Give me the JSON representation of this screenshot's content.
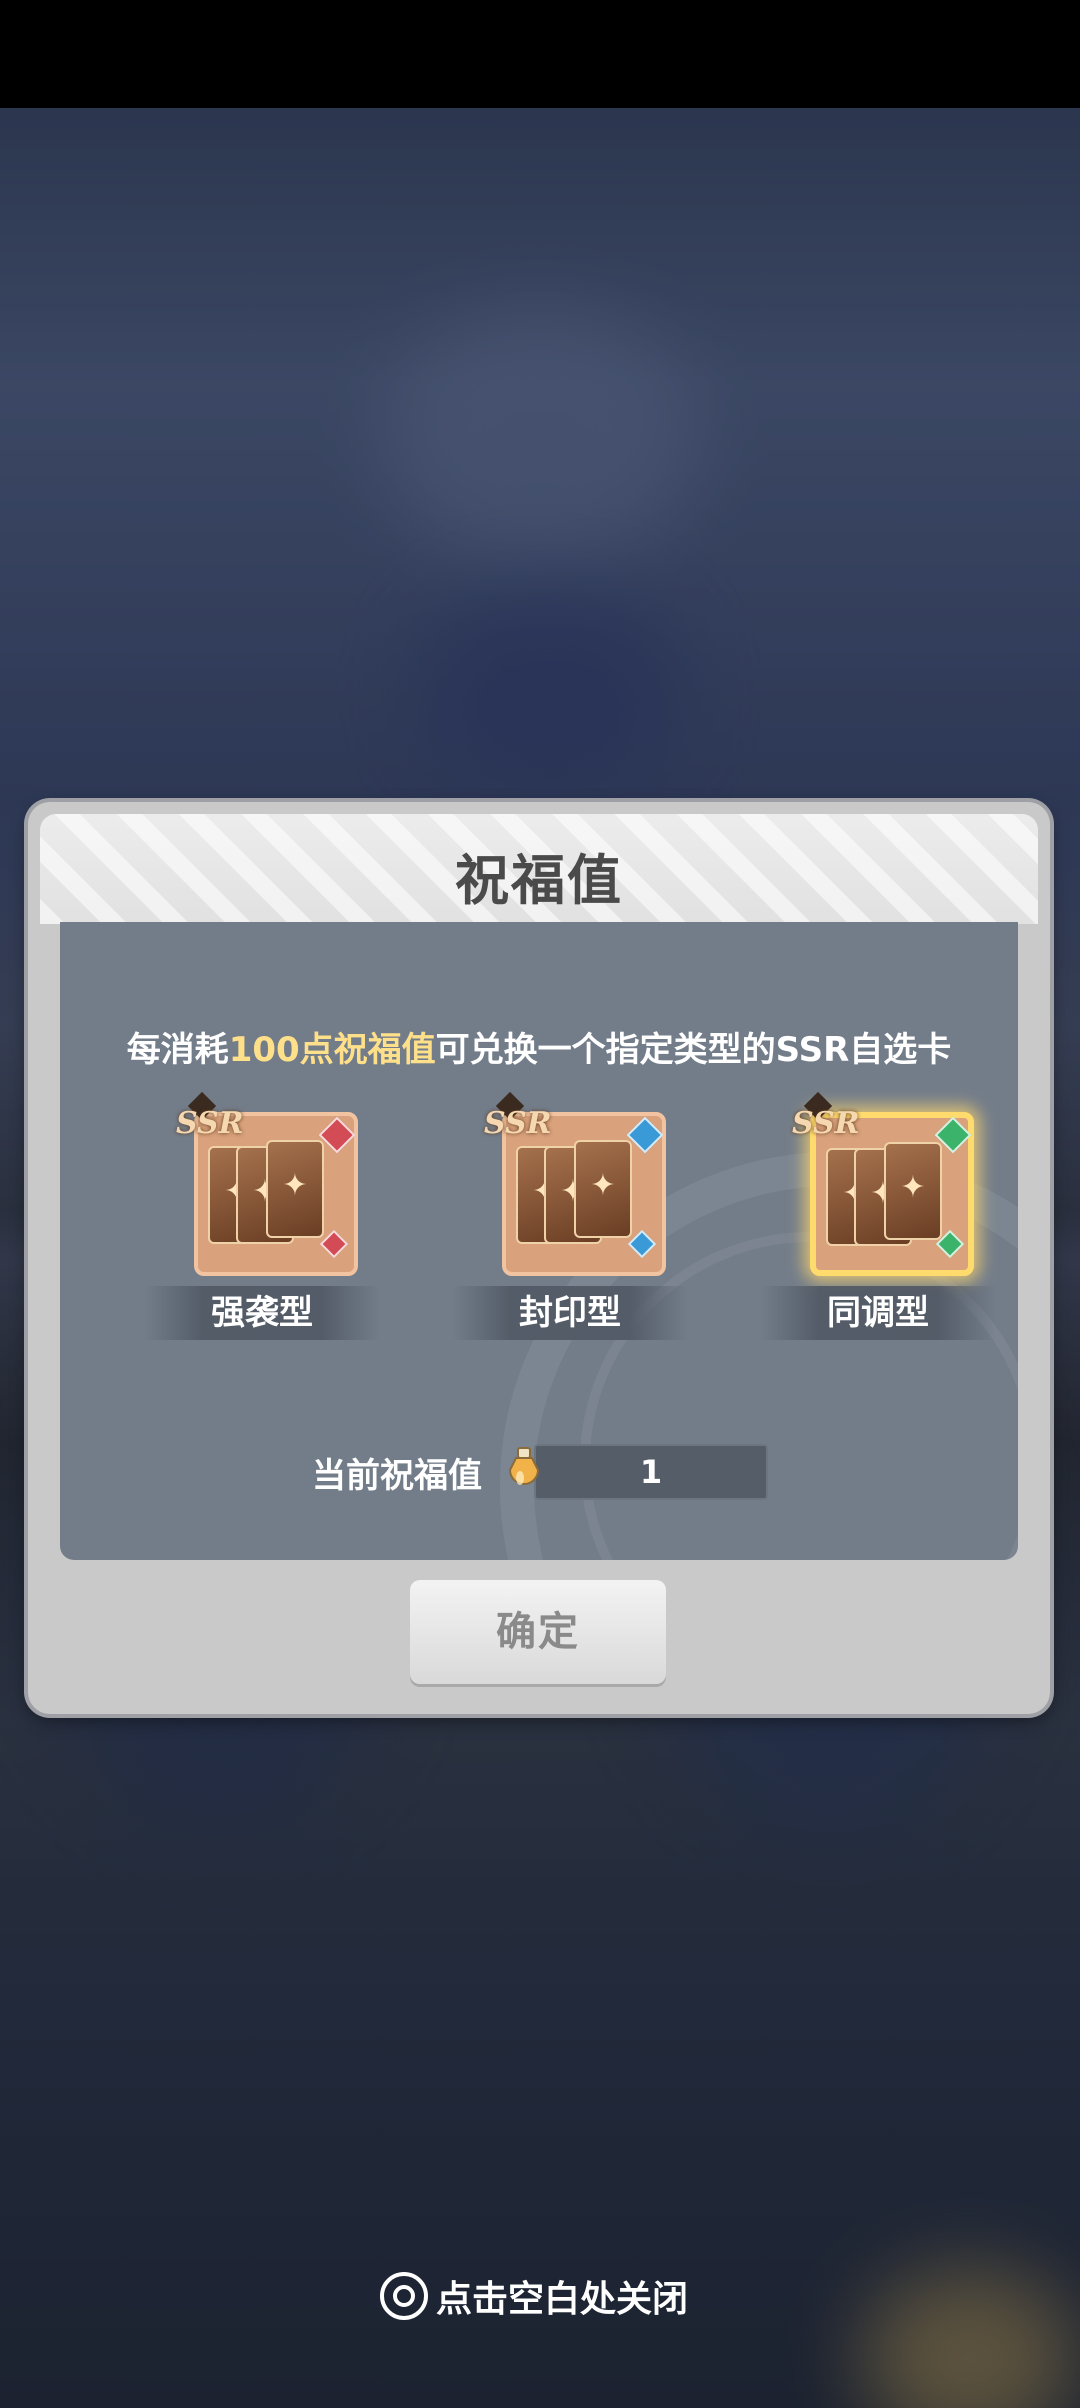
{
  "dialog": {
    "title": "祝福值",
    "description_prefix": "每消耗",
    "description_highlight": "100点祝福值",
    "description_suffix": "可兑换一个指定类型的SSR自选卡",
    "options": [
      {
        "label": "强袭型",
        "rarity": "SSR",
        "gem_color": "#d24b55",
        "selected": false
      },
      {
        "label": "封印型",
        "rarity": "SSR",
        "gem_color": "#3a9ad8",
        "selected": false
      },
      {
        "label": "同调型",
        "rarity": "SSR",
        "gem_color": "#3bb36a",
        "selected": true
      }
    ],
    "current_label": "当前祝福值",
    "current_value": "1",
    "confirm_label": "确定"
  },
  "close_hint": "点击空白处关闭"
}
